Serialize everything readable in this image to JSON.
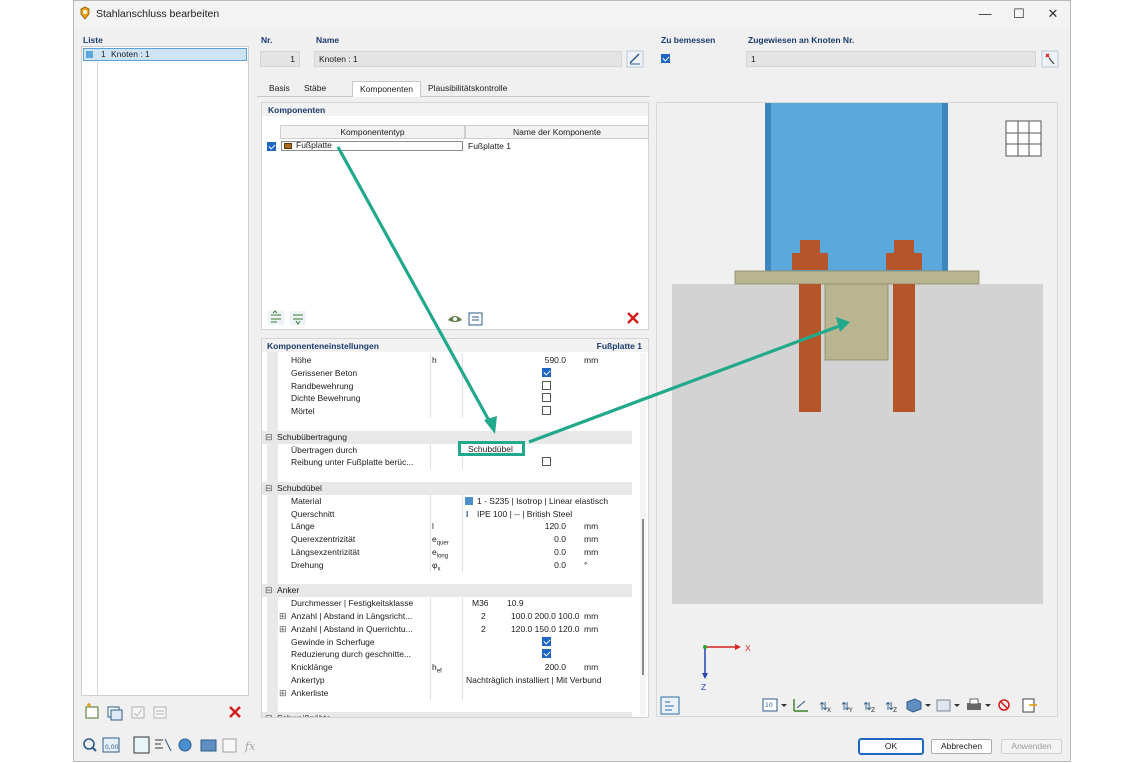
{
  "window": {
    "title": "Stahlanschluss bearbeiten"
  },
  "list": {
    "header": "Liste",
    "items": [
      {
        "nr": "1",
        "label": "Knoten : 1"
      }
    ]
  },
  "header": {
    "nr_label": "Nr.",
    "nr_value": "1",
    "name_label": "Name",
    "name_value": "Knoten : 1",
    "design_label": "Zu bemessen",
    "assigned_label": "Zugewiesen an Knoten Nr.",
    "assigned_value": "1"
  },
  "tabs": [
    "Basis",
    "Stäbe",
    "Komponenten",
    "Plausibilitätskontrolle"
  ],
  "active_tab": "Komponenten",
  "components": {
    "section_title": "Komponenten",
    "col_type": "Komponententyp",
    "col_name": "Name der Komponente",
    "rows": [
      {
        "checked": true,
        "type": "Fußplatte",
        "name": "Fußplatte 1",
        "color": "#a86a1c"
      }
    ]
  },
  "settings": {
    "title": "Komponenteneinstellungen",
    "current": "Fußplatte 1",
    "rows": [
      {
        "kind": "param",
        "label": "Höhe",
        "sym": "h",
        "value": "590.0",
        "unit": "mm"
      },
      {
        "kind": "check",
        "label": "Gerissener Beton",
        "checked": true
      },
      {
        "kind": "check",
        "label": "Randbewehrung",
        "checked": false
      },
      {
        "kind": "check",
        "label": "Dichte Bewehrung",
        "checked": false
      },
      {
        "kind": "check",
        "label": "Mörtel",
        "checked": false
      },
      {
        "kind": "blank"
      },
      {
        "kind": "section",
        "label": "Schubübertragung"
      },
      {
        "kind": "text",
        "label": "Übertragen durch",
        "value": "Schubdübel",
        "highlight": true
      },
      {
        "kind": "check",
        "label": "Reibung unter Fußplatte berüc...",
        "checked": false
      },
      {
        "kind": "blank"
      },
      {
        "kind": "section",
        "label": "Schubdübel"
      },
      {
        "kind": "material",
        "label": "Material",
        "value": "1 - S235 | Isotrop | Linear elastisch"
      },
      {
        "kind": "section_prop",
        "label": "Querschnitt",
        "value": "IPE 100 | -- | British Steel"
      },
      {
        "kind": "param",
        "label": "Länge",
        "sym": "l",
        "value": "120.0",
        "unit": "mm"
      },
      {
        "kind": "param",
        "label": "Querexzentrizität",
        "sym": "equer",
        "value": "0.0",
        "unit": "mm"
      },
      {
        "kind": "param",
        "label": "Längsexzentrizität",
        "sym": "elong",
        "value": "0.0",
        "unit": "mm"
      },
      {
        "kind": "param",
        "label": "Drehung",
        "sym": "φx",
        "value": "0.0",
        "unit": "°"
      },
      {
        "kind": "blank"
      },
      {
        "kind": "section",
        "label": "Anker"
      },
      {
        "kind": "pair",
        "label": "Durchmesser | Festigkeitsklasse",
        "a": "M36",
        "b": "10.9"
      },
      {
        "kind": "triple",
        "label": "Anzahl | Abstand in Längsricht...",
        "a": "2",
        "b": "100.0 200.0 100.0",
        "unit": "mm",
        "expand": true
      },
      {
        "kind": "triple",
        "label": "Anzahl | Abstand in Querrichtu...",
        "a": "2",
        "b": "120.0 150.0 120.0",
        "unit": "mm",
        "expand": true
      },
      {
        "kind": "check",
        "label": "Gewinde in Scherfuge",
        "checked": true
      },
      {
        "kind": "check",
        "label": "Reduzierung durch geschnitte...",
        "checked": true
      },
      {
        "kind": "param",
        "label": "Knicklänge",
        "sym": "hef",
        "value": "200.0",
        "unit": "mm"
      },
      {
        "kind": "text",
        "label": "Ankertyp",
        "value": "Nachträglich installiert | Mit Verbund"
      },
      {
        "kind": "expandrow",
        "label": "Ankerliste"
      },
      {
        "kind": "blank"
      },
      {
        "kind": "section",
        "label": "Schweißnähte"
      }
    ]
  },
  "viewer": {
    "axis_x": "X",
    "axis_z": "Z"
  },
  "buttons": {
    "ok": "OK",
    "cancel": "Abbrechen",
    "apply": "Anwenden"
  },
  "colors": {
    "column": "#5aa8dc",
    "plate": "#b9b590",
    "concrete": "#d3d3d3",
    "bolt": "#b5562a",
    "annotation": "#22a88a"
  }
}
